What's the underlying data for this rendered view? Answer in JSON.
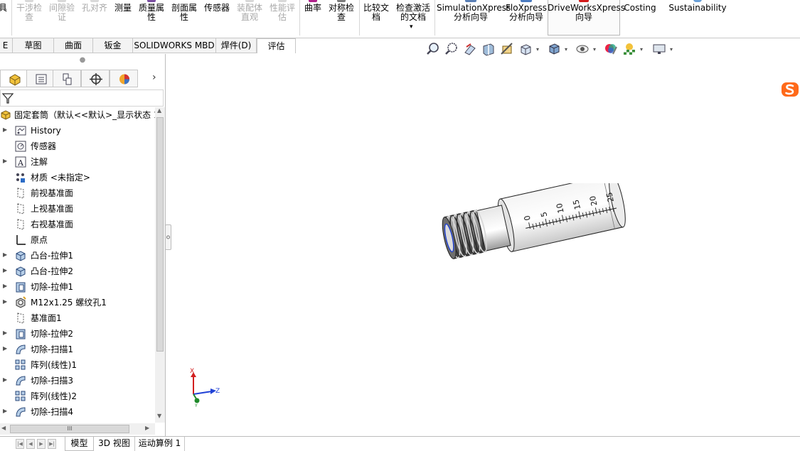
{
  "ribbon": {
    "buttons": [
      {
        "id": "rb-0",
        "label": "具",
        "disabled": false
      },
      {
        "id": "rb-1",
        "label": "干涉检\n查",
        "disabled": true
      },
      {
        "id": "rb-2",
        "label": "间隙验\n证",
        "disabled": true
      },
      {
        "id": "rb-3",
        "label": "孔对齐",
        "disabled": true
      },
      {
        "id": "rb-4",
        "label": "测量",
        "disabled": false
      },
      {
        "id": "rb-5",
        "label": "质量属\n性",
        "disabled": false
      },
      {
        "id": "rb-6",
        "label": "剖面属\n性",
        "disabled": false
      },
      {
        "id": "rb-7",
        "label": "传感器",
        "disabled": false
      },
      {
        "id": "rb-8",
        "label": "装配体\n直观",
        "disabled": true
      },
      {
        "id": "rb-9",
        "label": "性能评\n估",
        "disabled": true
      },
      {
        "id": "rb-10",
        "label": "曲率",
        "disabled": false
      },
      {
        "id": "rb-11",
        "label": "对称检\n查",
        "disabled": false
      },
      {
        "id": "rb-12",
        "label": "比较文\n档",
        "disabled": false
      },
      {
        "id": "rb-13",
        "label": "检查激活\n的文档",
        "disabled": false
      },
      {
        "id": "rb-14",
        "label": "SimulationXpress\n分析向导",
        "disabled": false
      },
      {
        "id": "rb-15",
        "label": "FloXpress\n分析向导",
        "disabled": false
      },
      {
        "id": "rb-16",
        "label": "DriveWorksXpress\n向导",
        "disabled": false
      },
      {
        "id": "rb-17",
        "label": "Costing",
        "disabled": false
      },
      {
        "id": "rb-18",
        "label": "Sustainability",
        "disabled": false
      }
    ],
    "check_doc_dropdown": "▾"
  },
  "command_tabs": [
    {
      "label": "E",
      "active": false
    },
    {
      "label": "草图",
      "active": false
    },
    {
      "label": "曲面",
      "active": false
    },
    {
      "label": "钣金",
      "active": false
    },
    {
      "label": "SOLIDWORKS MBD",
      "active": false
    },
    {
      "label": "焊件(D)",
      "active": false
    },
    {
      "label": "评估",
      "active": true
    }
  ],
  "feature_tree": {
    "root": "固定套筒（默认<<默认>_显示状态 1",
    "items": [
      {
        "label": "History",
        "expandable": true,
        "icon": "history-icon"
      },
      {
        "label": "传感器",
        "expandable": false,
        "icon": "sensor-icon"
      },
      {
        "label": "注解",
        "expandable": true,
        "icon": "annotation-icon"
      },
      {
        "label": "材质 <未指定>",
        "expandable": false,
        "icon": "material-icon"
      },
      {
        "label": "前视基准面",
        "expandable": false,
        "icon": "plane-icon"
      },
      {
        "label": "上视基准面",
        "expandable": false,
        "icon": "plane-icon"
      },
      {
        "label": "右视基准面",
        "expandable": false,
        "icon": "plane-icon"
      },
      {
        "label": "原点",
        "expandable": false,
        "icon": "origin-icon"
      },
      {
        "label": "凸台-拉伸1",
        "expandable": true,
        "icon": "boss-extrude-icon"
      },
      {
        "label": "凸台-拉伸2",
        "expandable": true,
        "icon": "boss-extrude-icon"
      },
      {
        "label": "切除-拉伸1",
        "expandable": true,
        "icon": "cut-extrude-icon"
      },
      {
        "label": "M12x1.25 螺纹孔1",
        "expandable": true,
        "icon": "hole-wizard-icon"
      },
      {
        "label": "基准面1",
        "expandable": false,
        "icon": "plane-icon"
      },
      {
        "label": "切除-拉伸2",
        "expandable": true,
        "icon": "cut-extrude-icon"
      },
      {
        "label": "切除-扫描1",
        "expandable": true,
        "icon": "cut-sweep-icon"
      },
      {
        "label": "阵列(线性)1",
        "expandable": false,
        "icon": "linear-pattern-icon"
      },
      {
        "label": "切除-扫描3",
        "expandable": true,
        "icon": "cut-sweep-icon"
      },
      {
        "label": "阵列(线性)2",
        "expandable": false,
        "icon": "linear-pattern-icon"
      },
      {
        "label": "切除-扫描4",
        "expandable": true,
        "icon": "cut-sweep-icon"
      }
    ]
  },
  "model": {
    "scale_labels": [
      "0",
      "5",
      "10",
      "15",
      "20",
      "25"
    ]
  },
  "triad": {
    "x": "X",
    "y": "Y",
    "z": "Z"
  },
  "bottom_tabs": [
    {
      "label": "模型",
      "active": true
    },
    {
      "label": "3D 视图",
      "active": false
    },
    {
      "label": "运动算例 1",
      "active": false
    }
  ],
  "scroll": {
    "grip": "III",
    "up": "▲",
    "down": "▼",
    "left": "◀",
    "right": "▶"
  }
}
